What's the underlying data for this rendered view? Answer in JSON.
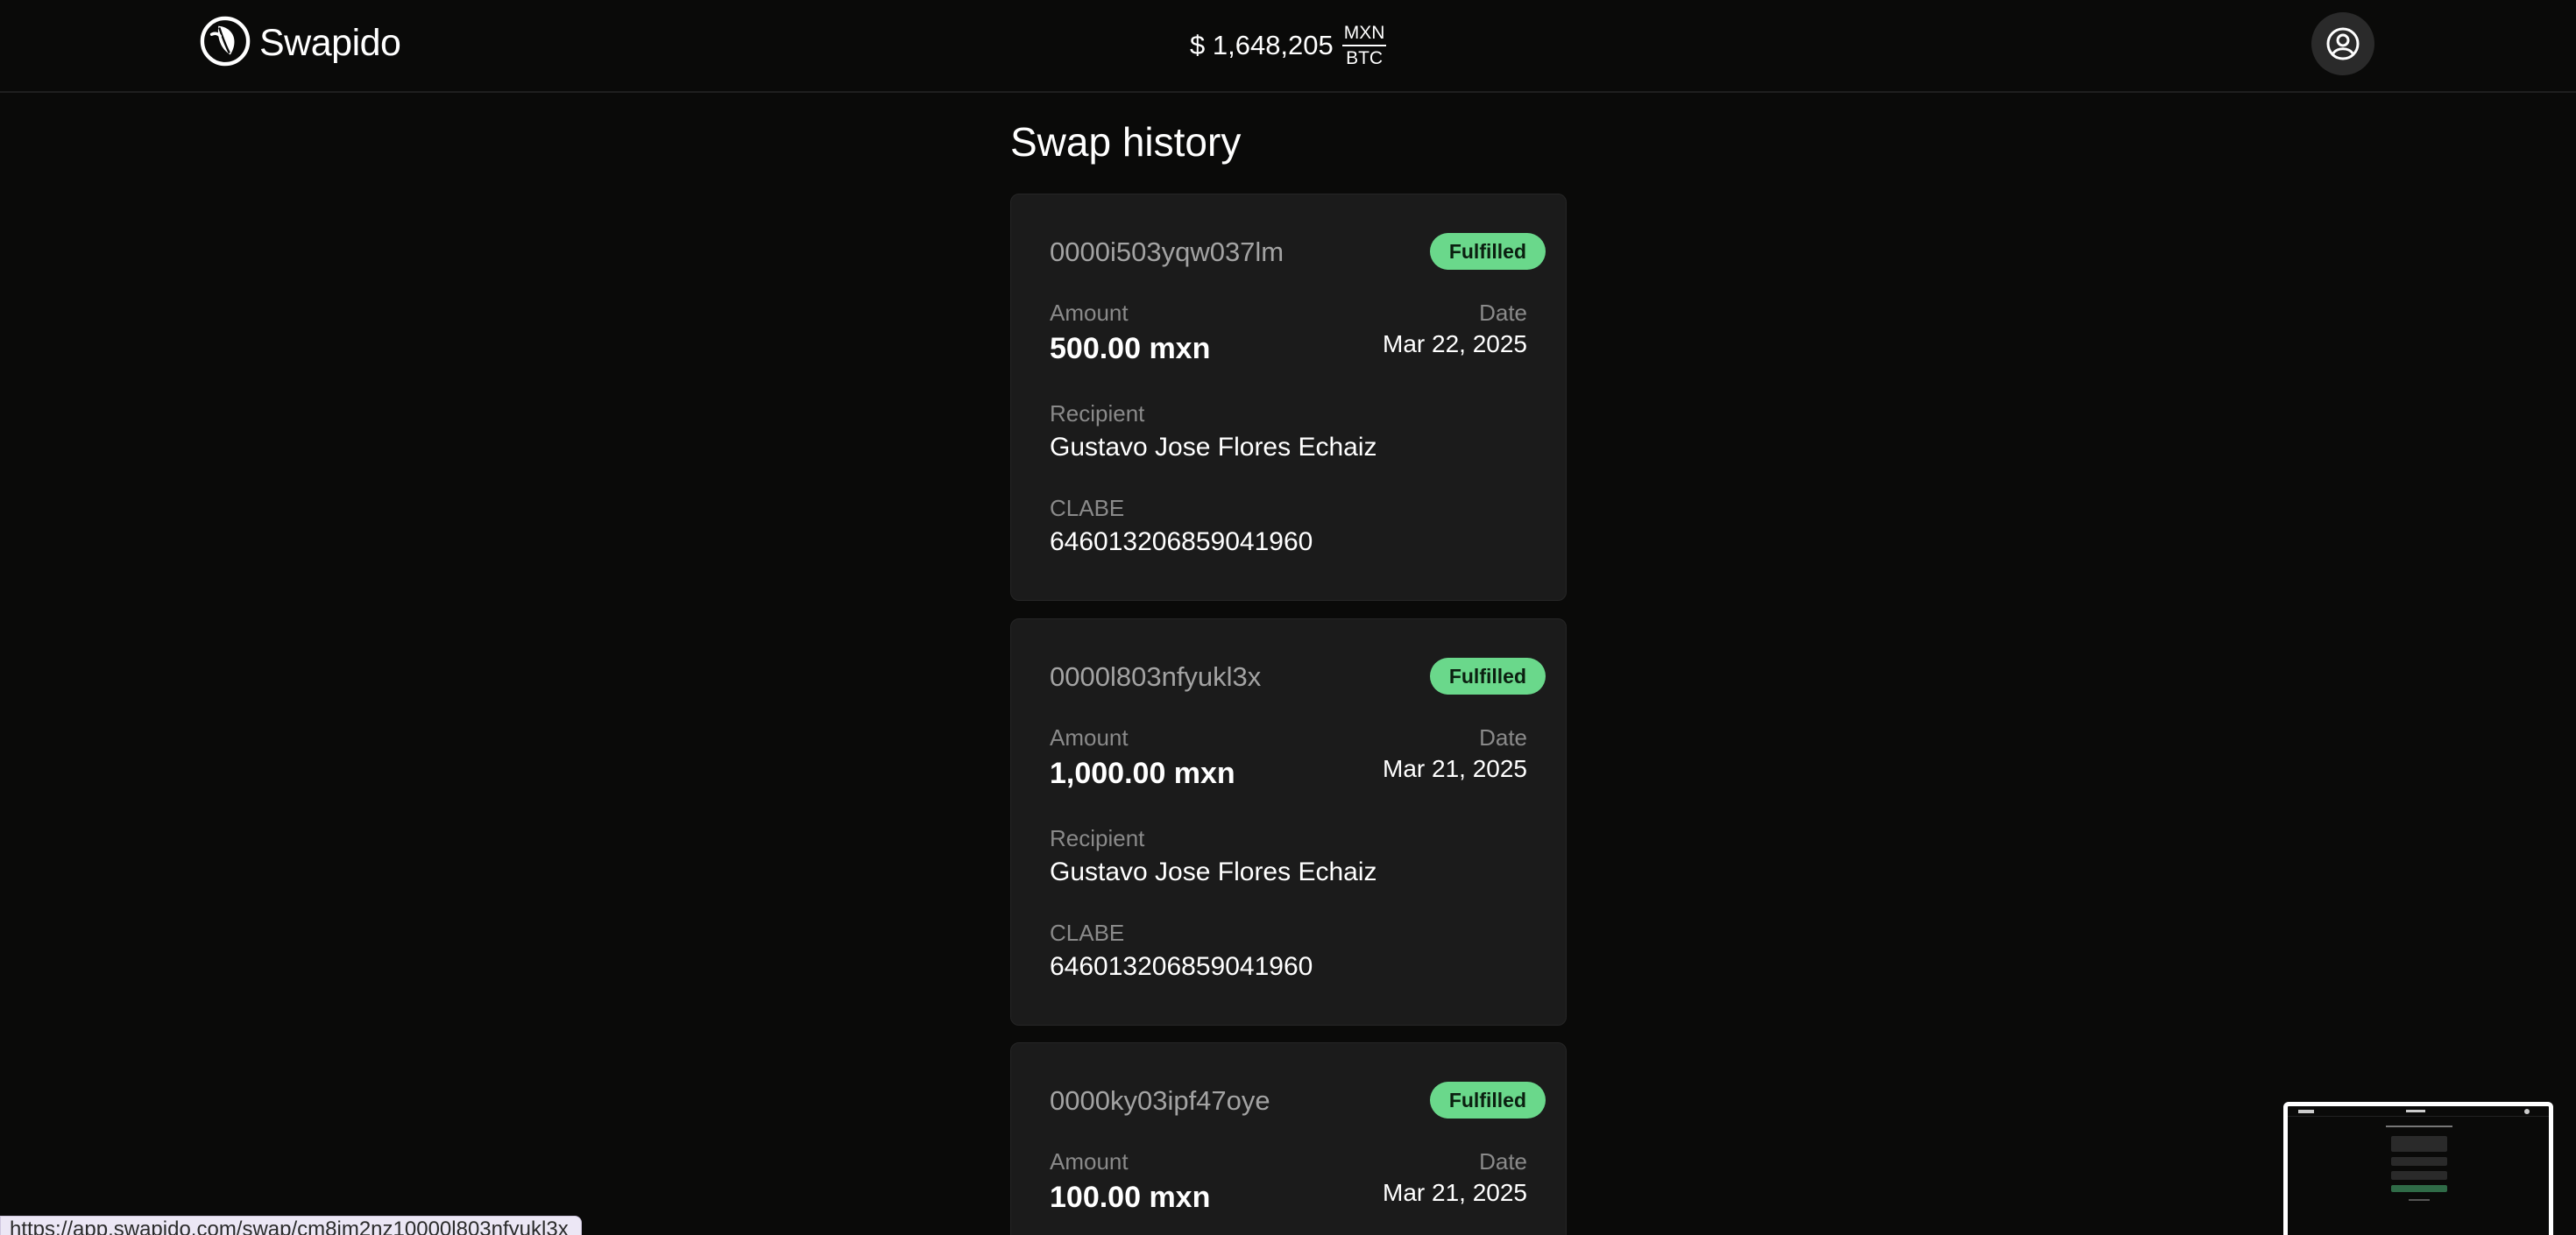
{
  "header": {
    "brand_name": "Swapido",
    "logo_icon": "swapido-leaf-logo",
    "rate": {
      "value": "$ 1,648,205",
      "base": "MXN",
      "quote": "BTC"
    },
    "profile_icon": "user-circle-icon"
  },
  "main": {
    "title": "Swap history",
    "swaps": [
      {
        "id": "0000i503yqw037lm",
        "status": "Fulfilled",
        "amount_label": "Amount",
        "amount": "500.00 mxn",
        "date_label": "Date",
        "date": "Mar 22, 2025",
        "recipient_label": "Recipient",
        "recipient": "Gustavo Jose Flores Echaiz",
        "clabe_label": "CLABE",
        "clabe": "646013206859041960"
      },
      {
        "id": "0000l803nfyukl3x",
        "status": "Fulfilled",
        "amount_label": "Amount",
        "amount": "1,000.00 mxn",
        "date_label": "Date",
        "date": "Mar 21, 2025",
        "recipient_label": "Recipient",
        "recipient": "Gustavo Jose Flores Echaiz",
        "clabe_label": "CLABE",
        "clabe": "646013206859041960"
      },
      {
        "id": "0000ky03ipf47oye",
        "status": "Fulfilled",
        "amount_label": "Amount",
        "amount": "100.00 mxn",
        "date_label": "Date",
        "date": "Mar 21, 2025"
      }
    ]
  },
  "statusbar": {
    "url": "https://app.swapido.com/swap/cm8im2nz10000l803nfyukl3x"
  },
  "colors": {
    "background": "#0a0a09",
    "card": "#1b1b1b",
    "badge_green": "#6ad88b",
    "muted_text": "#8a8a8a"
  }
}
